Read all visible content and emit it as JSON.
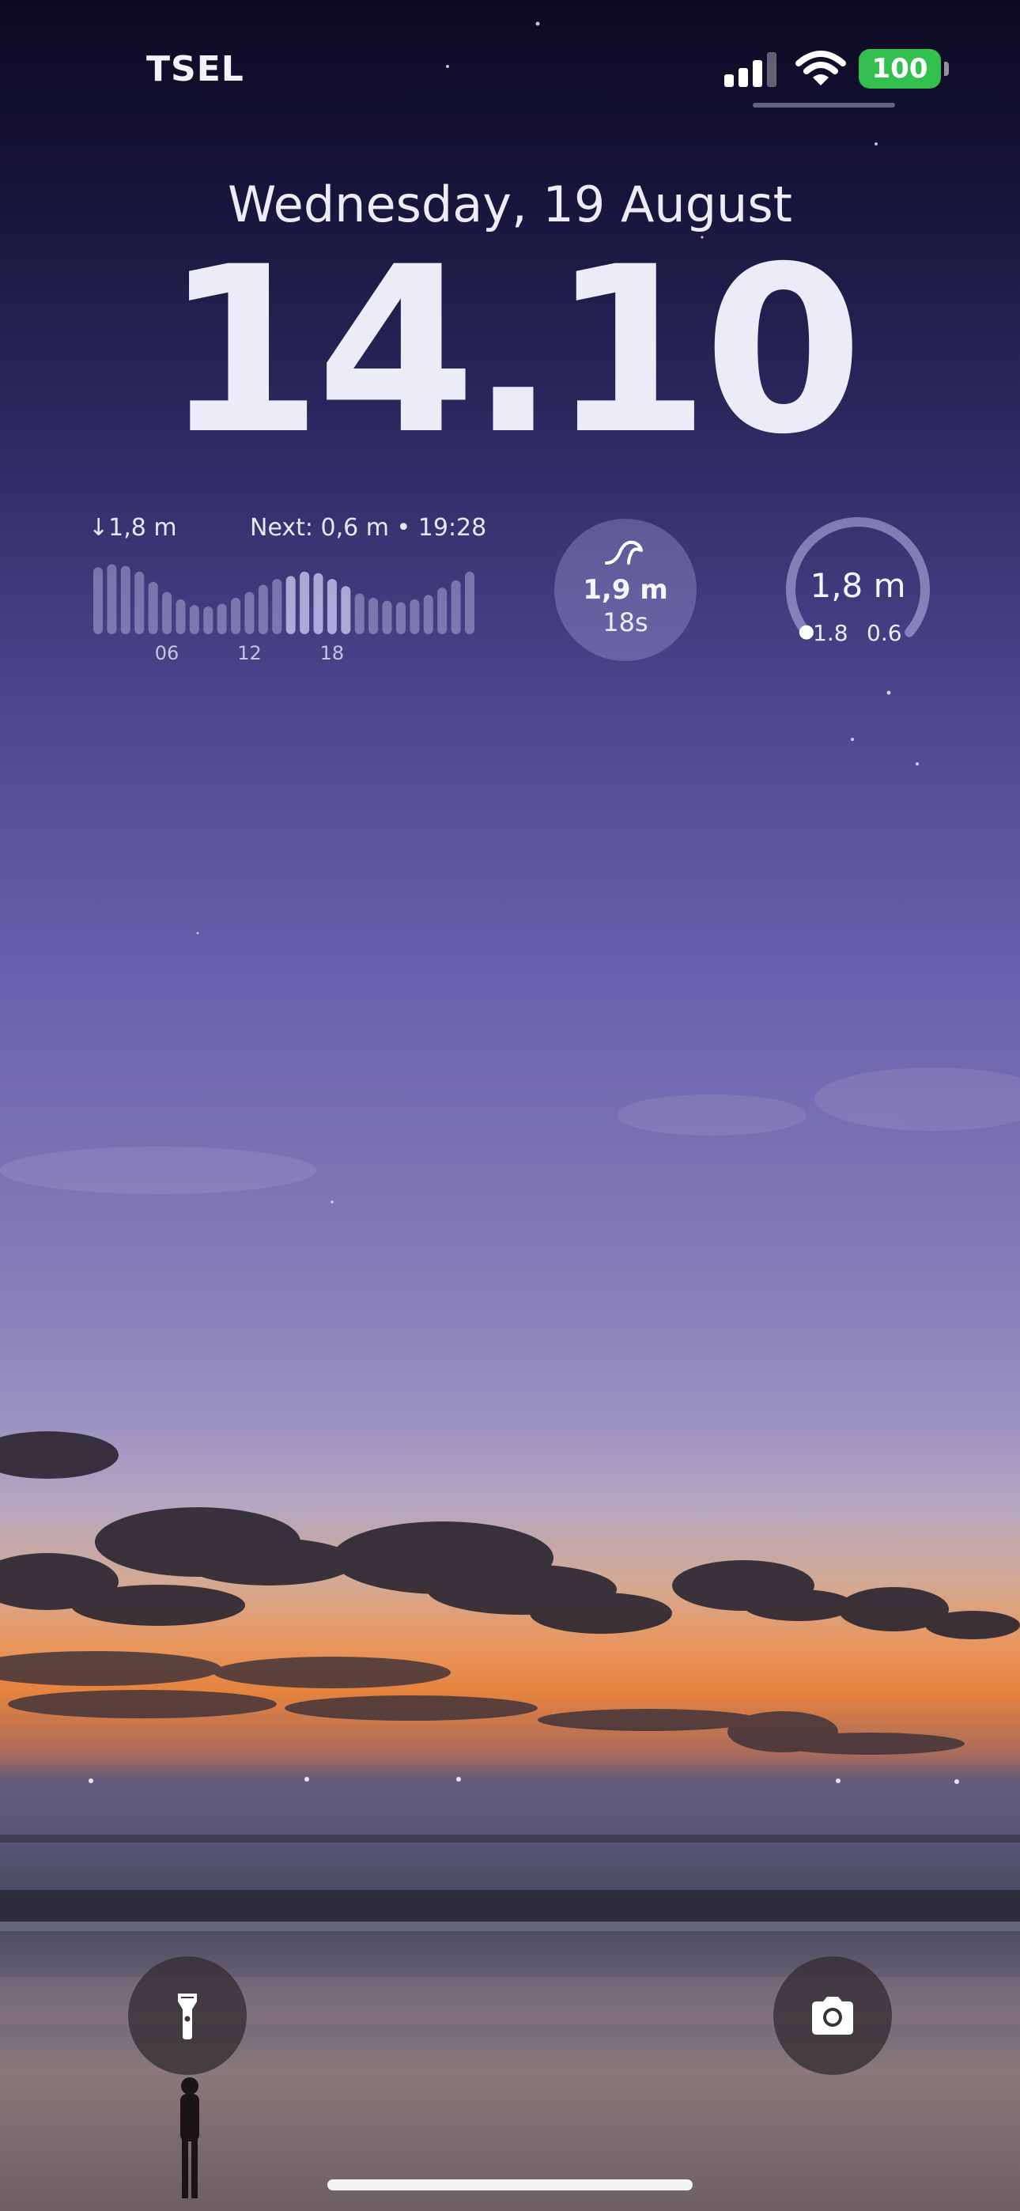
{
  "status_bar": {
    "carrier": "TSEL",
    "battery_level": "100",
    "signal_icon": "cellular-signal-icon",
    "wifi_icon": "wifi-icon",
    "battery_color": "#33c04f"
  },
  "lock_screen": {
    "date": "Wednesday, 19 August",
    "time": "14.10"
  },
  "widgets": {
    "tide": {
      "low_label": "↓1,8 m",
      "next_label": "Next:  0,6 m • 19:28",
      "chart_data": {
        "type": "bar",
        "description_values_are_relative_tide_levels": true,
        "values": [
          0.92,
          0.96,
          0.94,
          0.86,
          0.72,
          0.58,
          0.48,
          0.4,
          0.38,
          0.42,
          0.5,
          0.58,
          0.68,
          0.76,
          0.8,
          0.86,
          0.84,
          0.76,
          0.66,
          0.56,
          0.5,
          0.46,
          0.44,
          0.48,
          0.54,
          0.64,
          0.74,
          0.86
        ],
        "highlight_index_start": 14,
        "highlight_index_end": 18,
        "x_tick_labels": [
          "06",
          "12",
          "18"
        ],
        "x_tick_bar_index": [
          5,
          11,
          17
        ]
      }
    },
    "swell": {
      "icon": "wave-icon",
      "height": "1,9 m",
      "period": "18s"
    },
    "wave_gauge": {
      "value": "1,8 m",
      "min": "1.8",
      "max": "0.6",
      "fill_fraction": 0.25
    }
  },
  "quick_actions": {
    "flashlight_icon": "flashlight-icon",
    "camera_icon": "camera-icon"
  }
}
